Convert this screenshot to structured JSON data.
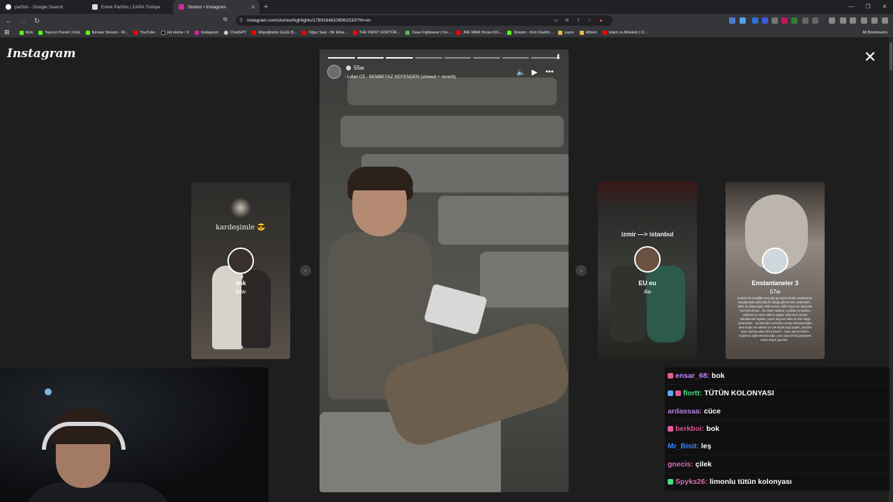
{
  "browser": {
    "tabs": [
      {
        "title": "parfüm - Google Search",
        "active": false
      },
      {
        "title": "Erkek Parfüm | ZARA Türkiye",
        "active": false
      },
      {
        "title": "Stories • Instagram",
        "active": true
      }
    ],
    "url": "instagram.com/stories/highlights/17891648109061530/?hl=en",
    "bookmarks": [
      "Kick",
      "Yayıncı Paneli | Kick",
      "İkinsan Stream - W...",
      "YouTube",
      "(4) Home / X",
      "Instagram",
      "ChatGPT",
      "Köpeğinizle Güçlü B...",
      "Oğuz Sasi - Bir Efsa...",
      "THE FIRST GÖKTÜR...",
      "Cave Fightwear | Ins...",
      "JRE MMA Show #16...",
      "Stream - Kick Dashb...",
      "yayın",
      "Albüm",
      "Islam vs Atheism | O..."
    ],
    "all_bookmarks": "All Bookmarks"
  },
  "instagram": {
    "logo": "Instagram",
    "current_story": {
      "time_ago": "55w",
      "song": "Lvbel C5 - BEMBEYAZ KEFENDEN (slowed + reverb)",
      "progress_total": 8,
      "progress_done": 3
    },
    "side_cards": [
      {
        "title": "kardeşimle 😎",
        "name": "znk",
        "age": "60w"
      },
      {
        "title": "izmir —> istanbul",
        "name": "EU eu",
        "age": "4w"
      },
      {
        "title": "",
        "name": "Enstantaneler 3",
        "age": "57w",
        "text": "halbuki tek istediğim tüm gibi gençlerin derdini paylaşmak, hayatlarıdaki yalnızlığı ilk olduğu gibi de olsa azaltmaktı... belki de düşmeliydi, belki hevesi, belki heyecanı takacaktı bize beli olmaz... bu insanı sadece o yoldan ve kaybını anlatma bu insan sadece yaşatır yıllarımızı zaman hatırlatacak hayatta, yayını kaçırsın birler bu kim deyip pezevakler... onunla bazı yerlerden cevap vermeyeceğim ama bugün bu adama ya çok büyük ayıp yaptık, yeryüzü bunu sarhoş adam bizi kurtardı... bunu sanırım bizim hiçbirimiz öğrenemeyeceğiz, yarın saat 10'da görüşmek üzere hayırlı geceler..."
      }
    ]
  },
  "chat": [
    {
      "user": "ensar_68:",
      "msg": "bok",
      "color": "#c084fc",
      "badge": "#e35d9b"
    },
    {
      "user": "flortt:",
      "msg": "TÜTÜN KOLONYASI",
      "color": "#4ade80",
      "badge": "#60a5fa"
    },
    {
      "user": "ardassaa:",
      "msg": "cüce",
      "color": "#b57edc",
      "badge": ""
    },
    {
      "user": "berkboi:",
      "msg": "bok",
      "color": "#e0528c",
      "badge": "#e35d9b"
    },
    {
      "user": "Mr_Bisit:",
      "msg": "leş",
      "color": "#3b82f6",
      "badge": ""
    },
    {
      "user": "gnecis:",
      "msg": "çilek",
      "color": "#d86db8",
      "badge": ""
    },
    {
      "user": "Spyks26:",
      "msg": "limonlu tütün kolonyası",
      "color": "#d86db8",
      "badge": "#4ade80"
    }
  ]
}
